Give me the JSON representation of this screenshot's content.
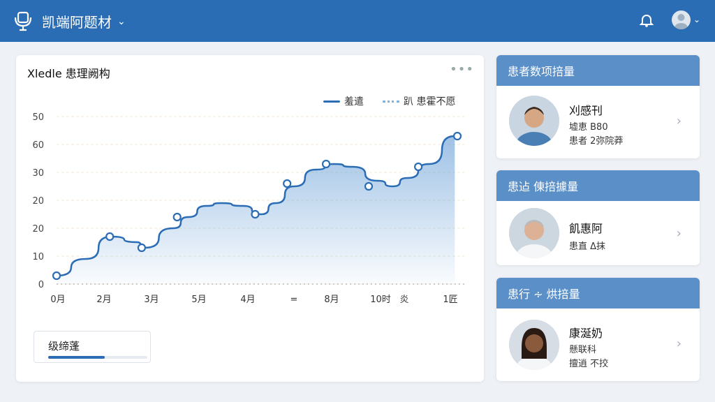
{
  "header": {
    "title": "凯端阿题材",
    "icons": {
      "logo": "stethoscope-icon",
      "notifications": "bell-icon",
      "avatar": "user-avatar",
      "menu": "chevron-down-icon"
    }
  },
  "chart_card": {
    "title": "Xledle 患理阙构",
    "menu_glyph": "•••",
    "legend": [
      {
        "label": "羞遣",
        "style": "solid",
        "color": "#2a6db5"
      },
      {
        "label": "趴 患霍不愿",
        "style": "dotted",
        "color": "#7fb2dd"
      }
    ],
    "progress": {
      "label": "级缔蓬",
      "fraction": 0.57
    }
  },
  "chart_data": {
    "type": "area",
    "y_ticks": [
      "0",
      "10",
      "20",
      "20",
      "30",
      "60",
      "50"
    ],
    "y_tick_values": [
      0,
      10,
      20,
      30,
      40,
      50,
      60
    ],
    "x_tick_labels": [
      "0月",
      "2月",
      "3月",
      "5月",
      "4月",
      "=",
      "8月",
      "10时",
      "炎",
      "1匠"
    ],
    "x_range": [
      0,
      10
    ],
    "ylim": [
      0,
      60
    ],
    "grid": true,
    "series": [
      {
        "name": "羞遣",
        "points": [
          [
            0,
            3
          ],
          [
            0.8,
            9
          ],
          [
            1.5,
            17
          ],
          [
            2.2,
            15
          ],
          [
            2.4,
            13
          ],
          [
            3.2,
            20
          ],
          [
            3.6,
            24
          ],
          [
            4.1,
            28
          ],
          [
            4.5,
            29
          ],
          [
            5.1,
            28
          ],
          [
            5.6,
            25
          ],
          [
            6.0,
            29
          ],
          [
            6.5,
            35
          ],
          [
            7.1,
            41
          ],
          [
            7.6,
            43
          ],
          [
            8.1,
            42
          ],
          [
            8.8,
            37
          ],
          [
            9.2,
            35
          ],
          [
            9.6,
            38
          ],
          [
            10.2,
            43
          ],
          [
            10.9,
            53
          ]
        ],
        "markers": [
          [
            0,
            3
          ],
          [
            1.5,
            17
          ],
          [
            2.4,
            13
          ],
          [
            3.4,
            24
          ],
          [
            5.6,
            25
          ],
          [
            6.5,
            36
          ],
          [
            7.6,
            43
          ],
          [
            8.8,
            35
          ],
          [
            10.2,
            42
          ],
          [
            11.3,
            53
          ]
        ]
      }
    ]
  },
  "patients": [
    {
      "head": "患者数项掊量",
      "name": "刈感刊",
      "line1": "墟恵 B80",
      "line2": "患者 2弥院莽",
      "avatar": "male-doctor-avatar"
    },
    {
      "head": "患迠 倲掊據量",
      "name": "飢惠阿",
      "line1": "患直 Δ抹",
      "line2": "",
      "avatar": "senior-doctor-avatar"
    },
    {
      "head": "患行 ∻ 烘掊量",
      "name": "康涎奶",
      "line1": "懸联科",
      "line2": "擅逍 不挍",
      "avatar": "female-doctor-avatar"
    }
  ]
}
